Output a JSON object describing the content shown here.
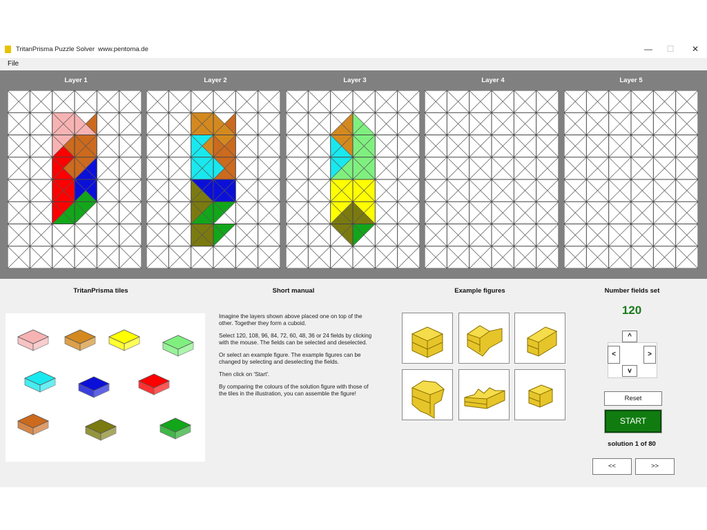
{
  "window": {
    "title": "TritanPrisma Puzzle Solver",
    "url": "www.pentoma.de",
    "controls": {
      "minimize": "—",
      "maximize": "☐",
      "close": "✕"
    }
  },
  "menu": {
    "file": "File"
  },
  "layers": [
    {
      "label": "Layer 1"
    },
    {
      "label": "Layer 2"
    },
    {
      "label": "Layer 3"
    },
    {
      "label": "Layer 4"
    },
    {
      "label": "Layer 5"
    }
  ],
  "grid": {
    "cols": 6,
    "rows": 8
  },
  "colors": {
    "pink": "#f7b3b3",
    "orange": "#d4891f",
    "brown": "#cc6a1e",
    "red": "#ff0000",
    "blue": "#0b10d8",
    "green": "#12a61a",
    "cyan": "#19e8ee",
    "olive": "#7b7a10",
    "yellow": "#ffff00",
    "lightgreen": "#7ff07f",
    "grid_bg": "#808080",
    "start_green": "#107c10"
  },
  "layer_cells": [
    [
      [
        2,
        1,
        "T",
        "pink"
      ],
      [
        2,
        1,
        "R",
        "pink"
      ],
      [
        2,
        1,
        "B",
        "pink"
      ],
      [
        2,
        1,
        "L",
        "pink"
      ],
      [
        3,
        1,
        "L",
        "pink"
      ],
      [
        3,
        1,
        "B",
        "pink"
      ],
      [
        2,
        2,
        "T",
        "pink"
      ],
      [
        2,
        2,
        "L",
        "pink"
      ],
      [
        2,
        2,
        "R",
        "brown"
      ],
      [
        2,
        2,
        "B",
        "red"
      ],
      [
        3,
        2,
        "T",
        "brown"
      ],
      [
        3,
        2,
        "L",
        "brown"
      ],
      [
        3,
        2,
        "R",
        "brown"
      ],
      [
        3,
        2,
        "B",
        "brown"
      ],
      [
        3,
        1,
        "R",
        "brown"
      ],
      [
        2,
        3,
        "T",
        "red"
      ],
      [
        2,
        3,
        "L",
        "red"
      ],
      [
        2,
        3,
        "B",
        "red"
      ],
      [
        2,
        3,
        "R",
        "brown"
      ],
      [
        3,
        3,
        "T",
        "brown"
      ],
      [
        3,
        3,
        "L",
        "brown"
      ],
      [
        3,
        3,
        "R",
        "blue"
      ],
      [
        3,
        3,
        "B",
        "blue"
      ],
      [
        2,
        4,
        "T",
        "red"
      ],
      [
        2,
        4,
        "L",
        "red"
      ],
      [
        2,
        4,
        "B",
        "red"
      ],
      [
        2,
        4,
        "R",
        "red"
      ],
      [
        3,
        4,
        "T",
        "blue"
      ],
      [
        3,
        4,
        "L",
        "blue"
      ],
      [
        3,
        4,
        "R",
        "blue"
      ],
      [
        3,
        4,
        "B",
        "green"
      ],
      [
        2,
        5,
        "T",
        "red"
      ],
      [
        2,
        5,
        "L",
        "red"
      ],
      [
        2,
        5,
        "R",
        "green"
      ],
      [
        2,
        5,
        "B",
        "green"
      ],
      [
        3,
        5,
        "T",
        "green"
      ],
      [
        3,
        5,
        "L",
        "green"
      ]
    ],
    [
      [
        2,
        1,
        "T",
        "orange"
      ],
      [
        2,
        1,
        "R",
        "orange"
      ],
      [
        2,
        1,
        "B",
        "orange"
      ],
      [
        2,
        1,
        "L",
        "orange"
      ],
      [
        3,
        1,
        "L",
        "orange"
      ],
      [
        3,
        1,
        "B",
        "orange"
      ],
      [
        3,
        1,
        "R",
        "brown"
      ],
      [
        2,
        2,
        "T",
        "cyan"
      ],
      [
        2,
        2,
        "L",
        "cyan"
      ],
      [
        2,
        2,
        "B",
        "cyan"
      ],
      [
        2,
        2,
        "R",
        "orange"
      ],
      [
        3,
        2,
        "T",
        "orange"
      ],
      [
        3,
        2,
        "L",
        "brown"
      ],
      [
        3,
        2,
        "R",
        "brown"
      ],
      [
        3,
        2,
        "B",
        "brown"
      ],
      [
        2,
        3,
        "T",
        "cyan"
      ],
      [
        2,
        3,
        "L",
        "cyan"
      ],
      [
        2,
        3,
        "B",
        "cyan"
      ],
      [
        2,
        3,
        "R",
        "cyan"
      ],
      [
        3,
        3,
        "T",
        "brown"
      ],
      [
        3,
        3,
        "L",
        "cyan"
      ],
      [
        3,
        3,
        "R",
        "brown"
      ],
      [
        3,
        3,
        "B",
        "brown"
      ],
      [
        2,
        4,
        "T",
        "blue"
      ],
      [
        2,
        4,
        "R",
        "blue"
      ],
      [
        2,
        4,
        "L",
        "olive"
      ],
      [
        2,
        4,
        "B",
        "olive"
      ],
      [
        3,
        4,
        "T",
        "blue"
      ],
      [
        3,
        4,
        "L",
        "blue"
      ],
      [
        3,
        4,
        "R",
        "blue"
      ],
      [
        3,
        4,
        "B",
        "blue"
      ],
      [
        2,
        5,
        "T",
        "olive"
      ],
      [
        2,
        5,
        "L",
        "olive"
      ],
      [
        2,
        5,
        "R",
        "green"
      ],
      [
        2,
        5,
        "B",
        "green"
      ],
      [
        3,
        5,
        "T",
        "green"
      ],
      [
        3,
        5,
        "L",
        "green"
      ],
      [
        2,
        6,
        "T",
        "olive"
      ],
      [
        2,
        6,
        "L",
        "olive"
      ],
      [
        2,
        6,
        "B",
        "olive"
      ],
      [
        2,
        6,
        "R",
        "olive"
      ],
      [
        3,
        6,
        "T",
        "green"
      ],
      [
        3,
        6,
        "L",
        "green"
      ]
    ],
    [
      [
        2,
        1,
        "R",
        "orange"
      ],
      [
        2,
        1,
        "B",
        "orange"
      ],
      [
        3,
        1,
        "L",
        "lightgreen"
      ],
      [
        3,
        1,
        "B",
        "lightgreen"
      ],
      [
        2,
        2,
        "T",
        "orange"
      ],
      [
        2,
        2,
        "R",
        "orange"
      ],
      [
        2,
        2,
        "L",
        "cyan"
      ],
      [
        2,
        2,
        "B",
        "cyan"
      ],
      [
        3,
        2,
        "T",
        "lightgreen"
      ],
      [
        3,
        2,
        "L",
        "lightgreen"
      ],
      [
        3,
        2,
        "R",
        "lightgreen"
      ],
      [
        3,
        2,
        "B",
        "lightgreen"
      ],
      [
        2,
        3,
        "T",
        "cyan"
      ],
      [
        2,
        3,
        "L",
        "cyan"
      ],
      [
        2,
        3,
        "R",
        "lightgreen"
      ],
      [
        2,
        3,
        "B",
        "lightgreen"
      ],
      [
        3,
        3,
        "T",
        "lightgreen"
      ],
      [
        3,
        3,
        "L",
        "lightgreen"
      ],
      [
        3,
        3,
        "R",
        "lightgreen"
      ],
      [
        3,
        3,
        "B",
        "lightgreen"
      ],
      [
        2,
        4,
        "T",
        "yellow"
      ],
      [
        2,
        4,
        "L",
        "yellow"
      ],
      [
        2,
        4,
        "R",
        "yellow"
      ],
      [
        2,
        4,
        "B",
        "yellow"
      ],
      [
        3,
        4,
        "T",
        "yellow"
      ],
      [
        3,
        4,
        "L",
        "yellow"
      ],
      [
        3,
        4,
        "R",
        "yellow"
      ],
      [
        3,
        4,
        "B",
        "yellow"
      ],
      [
        2,
        5,
        "T",
        "yellow"
      ],
      [
        2,
        5,
        "L",
        "yellow"
      ],
      [
        2,
        5,
        "R",
        "olive"
      ],
      [
        2,
        5,
        "B",
        "olive"
      ],
      [
        3,
        5,
        "T",
        "yellow"
      ],
      [
        3,
        5,
        "R",
        "yellow"
      ],
      [
        3,
        5,
        "L",
        "olive"
      ],
      [
        3,
        5,
        "B",
        "olive"
      ],
      [
        2,
        6,
        "T",
        "olive"
      ],
      [
        2,
        6,
        "R",
        "olive"
      ],
      [
        3,
        6,
        "T",
        "green"
      ],
      [
        3,
        6,
        "L",
        "green"
      ]
    ],
    [],
    []
  ],
  "sections": {
    "tiles_title": "TritanPrisma tiles",
    "manual_title": "Short manual",
    "examples_title": "Example figures",
    "fields_title": "Number fields set"
  },
  "manual": [
    "Imagine the layers shown above placed one on top of the other. Together they form a cuboid.",
    "Select 120, 108, 96, 84, 72, 60, 48, 36 or 24 fields by clicking with the mouse. The fields can be selected and deselected.",
    "Or select an example figure. The example figures can be changed by selecting and deselecting the fields.",
    "Then click on 'Start'.",
    "By comparing the colours of the solution figure with those of the tiles in the illustration, you can assemble the figure!"
  ],
  "tiles": [
    "pink",
    "orange",
    "yellow",
    "lightgreen",
    "cyan",
    "blue",
    "red",
    "brown",
    "olive",
    "green"
  ],
  "count": "120",
  "arrows": {
    "up": "^",
    "left": "<",
    "right": ">",
    "down": "v"
  },
  "buttons": {
    "reset": "Reset",
    "start": "START",
    "prev": "<<",
    "next": ">>"
  },
  "solution": "solution  1 of 80"
}
